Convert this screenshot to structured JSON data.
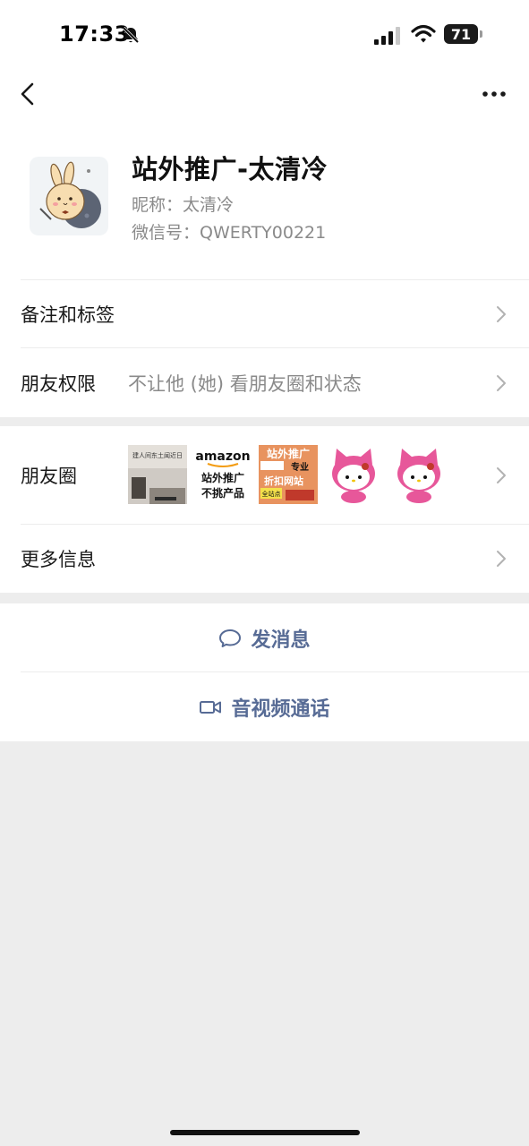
{
  "status_bar": {
    "time": "17:33",
    "battery": "71"
  },
  "profile": {
    "name": "站外推广-太清冷",
    "nickname": "昵称：太清冷",
    "wechat_id": "微信号：QWERTY00221"
  },
  "cells": {
    "remarks_label": "备注和标签",
    "permissions_label": "朋友权限",
    "permissions_value": "不让他 (她) 看朋友圈和状态",
    "moments_label": "朋友圈",
    "more_info_label": "更多信息"
  },
  "moments_thumbs": {
    "t1_text": "建人间东土闻近日",
    "t2_brand": "amazon",
    "t2_line1": "站外推广",
    "t2_line2": "不挑产品",
    "t3_line1": "站外推广",
    "t3_line2": "专业",
    "t3_line3": "折扣网站",
    "t3_line4": "全站点"
  },
  "actions": {
    "message_label": "发消息",
    "video_call_label": "音视频通话"
  },
  "colors": {
    "link": "#576b95",
    "background": "#ededed"
  }
}
